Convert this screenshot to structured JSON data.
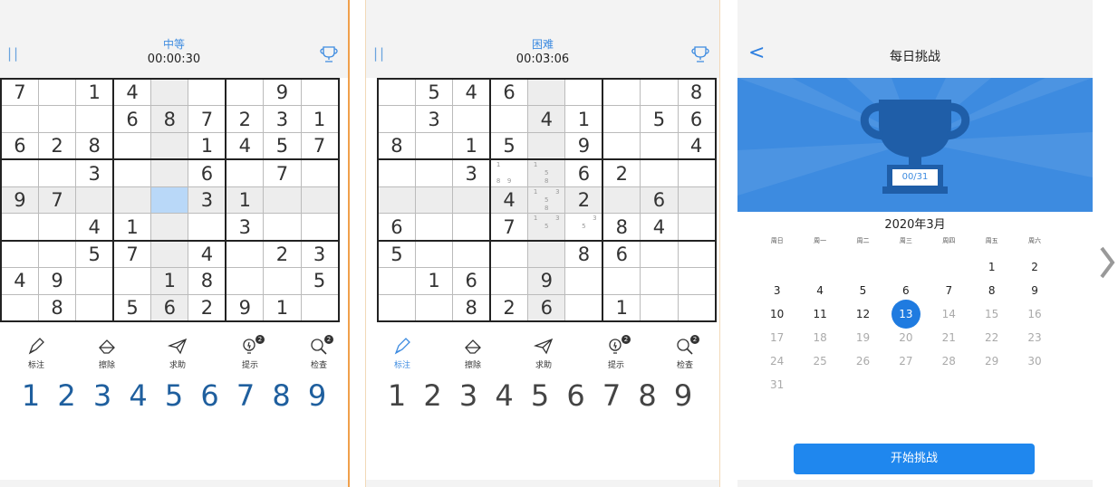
{
  "colors": {
    "accent": "#3d8be0",
    "header_bg": "#f3f3f3",
    "selected_cell": "#b9d8f8",
    "highlight_cell": "#ededed",
    "divider": "#f0a04b",
    "button": "#1f87ee"
  },
  "screen1": {
    "difficulty": "中等",
    "timer": "00:00:30",
    "pause_icon": "||",
    "grid": [
      [
        "7",
        "",
        "1",
        "4",
        "",
        "",
        "",
        "9",
        ""
      ],
      [
        "",
        "",
        "",
        "6",
        "8",
        "7",
        "2",
        "3",
        "1"
      ],
      [
        "6",
        "2",
        "8",
        "",
        "",
        "1",
        "4",
        "5",
        "7"
      ],
      [
        "",
        "",
        "3",
        "",
        "",
        "6",
        "",
        "7",
        ""
      ],
      [
        "9",
        "7",
        "",
        "",
        "",
        "3",
        "1",
        "",
        ""
      ],
      [
        "",
        "",
        "4",
        "1",
        "",
        "",
        "3",
        "",
        ""
      ],
      [
        "",
        "",
        "5",
        "7",
        "",
        "4",
        "",
        "2",
        "3"
      ],
      [
        "4",
        "9",
        "",
        "",
        "1",
        "8",
        "",
        "",
        "5"
      ],
      [
        "",
        "8",
        "",
        "5",
        "6",
        "2",
        "9",
        "1",
        ""
      ]
    ],
    "tools": [
      {
        "label": "标注",
        "icon": "pencil-icon",
        "badge": ""
      },
      {
        "label": "擦除",
        "icon": "eraser-icon",
        "badge": ""
      },
      {
        "label": "求助",
        "icon": "paper-plane-icon",
        "badge": ""
      },
      {
        "label": "提示",
        "icon": "bulb-icon",
        "badge": "2"
      },
      {
        "label": "检查",
        "icon": "magnifier-icon",
        "badge": "2"
      }
    ],
    "numbers": [
      "1",
      "2",
      "3",
      "4",
      "5",
      "6",
      "7",
      "8",
      "9"
    ],
    "number_color": "#1f5f9e"
  },
  "screen2": {
    "difficulty": "困难",
    "timer": "00:03:06",
    "pause_icon": "||",
    "grid": [
      [
        "",
        "5",
        "4",
        "6",
        "",
        "",
        "",
        "",
        "8"
      ],
      [
        "",
        "3",
        "",
        "",
        "4",
        "1",
        "",
        "5",
        "6"
      ],
      [
        "8",
        "",
        "1",
        "5",
        "",
        "9",
        "",
        "",
        "4"
      ],
      [
        "",
        "",
        "3",
        "",
        "",
        "6",
        "2",
        "",
        ""
      ],
      [
        "",
        "",
        "",
        "4",
        "",
        "2",
        "",
        "6",
        ""
      ],
      [
        "6",
        "",
        "",
        "7",
        "",
        "",
        "8",
        "4",
        ""
      ],
      [
        "5",
        "",
        "",
        "",
        "",
        "8",
        "6",
        "",
        ""
      ],
      [
        "",
        "1",
        "6",
        "",
        "9",
        "",
        "",
        "",
        ""
      ],
      [
        "",
        "",
        "8",
        "2",
        "6",
        "",
        "1",
        "",
        ""
      ]
    ],
    "notes": {
      "3,3": [
        "1",
        "",
        "",
        "",
        "",
        "",
        "8",
        "9",
        ""
      ],
      "3,4": [
        "1",
        "",
        "",
        "",
        "5",
        "",
        "",
        "8",
        ""
      ],
      "4,4": [
        "1",
        "",
        "3",
        "",
        "5",
        "",
        "",
        "8",
        ""
      ],
      "5,4": [
        "1",
        "",
        "3",
        "",
        "5",
        "",
        "",
        "",
        ""
      ],
      "5,5": [
        "",
        "",
        "3",
        "",
        "5",
        "",
        "",
        "",
        ""
      ]
    },
    "tools": [
      {
        "label": "标注",
        "icon": "pencil-icon",
        "badge": ""
      },
      {
        "label": "擦除",
        "icon": "eraser-icon",
        "badge": ""
      },
      {
        "label": "求助",
        "icon": "paper-plane-icon",
        "badge": ""
      },
      {
        "label": "提示",
        "icon": "bulb-icon",
        "badge": "2"
      },
      {
        "label": "检查",
        "icon": "magnifier-icon",
        "badge": "2"
      }
    ],
    "numbers": [
      "1",
      "2",
      "3",
      "4",
      "5",
      "6",
      "7",
      "8",
      "9"
    ],
    "number_color": "#444444"
  },
  "screen3": {
    "back": "<",
    "title": "每日挑战",
    "progress": "00/31",
    "month": "2020年3月",
    "weekdays": [
      "周日",
      "周一",
      "周二",
      "周三",
      "周四",
      "周五",
      "周六"
    ],
    "weeks": [
      [
        "",
        "",
        "",
        "",
        "",
        "1",
        "2"
      ],
      [
        "3",
        "4",
        "5",
        "6",
        "7",
        "8",
        "9"
      ],
      [
        "10",
        "11",
        "12",
        "13",
        "14",
        "15",
        "16"
      ],
      [
        "17",
        "18",
        "19",
        "20",
        "21",
        "22",
        "23"
      ],
      [
        "24",
        "25",
        "26",
        "27",
        "28",
        "29",
        "30"
      ],
      [
        "31",
        "",
        "",
        "",
        "",
        "",
        ""
      ]
    ],
    "today": "13",
    "start_button": "开始挑战"
  }
}
